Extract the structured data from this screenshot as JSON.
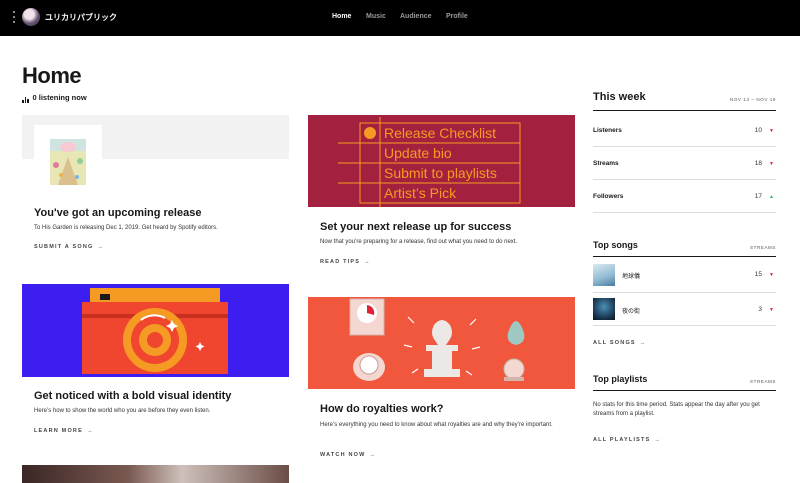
{
  "header": {
    "artist_name": "ユリカリパブリック",
    "nav": [
      "Home",
      "Music",
      "Audience",
      "Profile"
    ],
    "active_tab": "Home"
  },
  "page": {
    "title": "Home",
    "listening": "0 listening now"
  },
  "cards": {
    "upcoming": {
      "title": "You've got an upcoming release",
      "desc": "To His Garden is releasing Dec 1, 2019. Get heard by Spotify editors.",
      "cta": "SUBMIT A SONG"
    },
    "release": {
      "checklist": [
        "Release Checklist",
        "Update bio",
        "Submit to playlists",
        "Artist’s Pick"
      ],
      "title": "Set your next release up for success",
      "desc": "Now that you’re preparing for a release, find out what you need to do next.",
      "cta": "READ TIPS"
    },
    "identity": {
      "title": "Get noticed with a bold visual identity",
      "desc": "Here’s how to show the world who you are before they even listen.",
      "cta": "LEARN MORE"
    },
    "royalties": {
      "title": "How do royalties work?",
      "desc": "Here’s everything you need to know about what royalties are and why they’re important.",
      "cta": "WATCH NOW"
    },
    "arrow": "→"
  },
  "sidebar": {
    "week_title": "This week",
    "date_range": "NOV 13 – NOV 19",
    "stats": [
      {
        "label": "Listeners",
        "value": "10",
        "trend": "▼"
      },
      {
        "label": "Streams",
        "value": "18",
        "trend": "▼"
      },
      {
        "label": "Followers",
        "value": "17",
        "trend": "▲"
      }
    ],
    "top_songs_title": "Top songs",
    "streams_label": "STREAMS",
    "songs": [
      {
        "name": "地球儀",
        "streams": "15",
        "trend": "▼"
      },
      {
        "name": "夜の街",
        "streams": "3",
        "trend": "▼"
      }
    ],
    "all_songs": "ALL SONGS",
    "top_playlists_title": "Top playlists",
    "playlists_note": "No stats for this time period. Stats appear the day after you get streams from a playlist.",
    "all_playlists": "ALL PLAYLISTS"
  },
  "colors": {
    "topbar": "#000000",
    "release_bg": "#a3203e",
    "release_text": "#f59b23",
    "identity_bg": "#3d1ef0",
    "camera_body": "#f0452f",
    "camera_top": "#f59b23",
    "royalties_bg": "#f0573c",
    "trend_down": "#e22134",
    "trend_up": "#1db954"
  }
}
